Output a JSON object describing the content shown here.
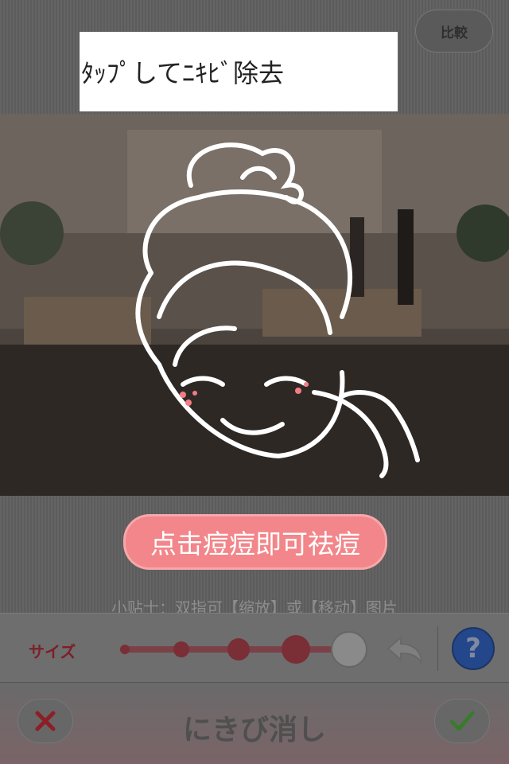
{
  "header": {
    "compare_label": "比較",
    "banner_text": "ﾀｯﾌﾟしてﾆｷﾋﾞ除去"
  },
  "guide": {
    "tip_text": "点击痘痘即可祛痘",
    "hint_text": "小贴士：双指可【缩放】或【移动】图片"
  },
  "size_bar": {
    "label": "サイズ",
    "size_levels": 5,
    "selected_level": 5,
    "undo_icon": "undo-arrow-icon",
    "help_label": "?"
  },
  "bottom_bar": {
    "title": "にきび消し",
    "cancel_icon": "close-icon",
    "confirm_icon": "checkmark-icon"
  },
  "colors": {
    "tip_pink": "#f2868a",
    "help_blue": "#24468a",
    "cancel_red": "#8c1f25",
    "confirm_green": "#3b7a2e"
  }
}
